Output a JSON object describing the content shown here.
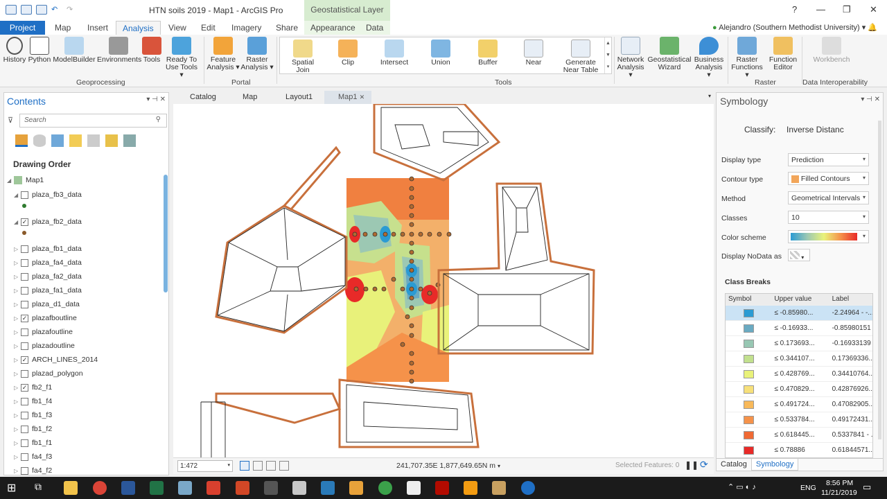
{
  "window": {
    "title": "HTN soils 2019 - Map1 - ArcGIS Pro",
    "context_tab_group": "Geostatistical Layer",
    "help": "?",
    "minimize": "—",
    "maximize": "❐",
    "close": "✕"
  },
  "tabs": {
    "project": "Project",
    "map": "Map",
    "insert": "Insert",
    "analysis": "Analysis",
    "view": "View",
    "edit": "Edit",
    "imagery": "Imagery",
    "share": "Share",
    "appearance": "Appearance",
    "data": "Data"
  },
  "user": "Alejandro (Southern Methodist University)",
  "ribbon": {
    "history": "History",
    "python": "Python",
    "modelbuilder": "ModelBuilder",
    "environments": "Environments",
    "tools": "Tools",
    "ready1": "Ready To",
    "ready2": "Use Tools ▾",
    "geoprocessing": "Geoprocessing",
    "feature1": "Feature",
    "feature2": "Analysis ▾",
    "raster1": "Raster",
    "raster2": "Analysis ▾",
    "portal": "Portal",
    "spatial1": "Spatial",
    "spatial2": "Join",
    "clip": "Clip",
    "intersect": "Intersect",
    "union": "Union",
    "buffer": "Buffer",
    "near": "Near",
    "gnt1": "Generate",
    "gnt2": "Near Table",
    "tools_group": "Tools",
    "network1": "Network",
    "network2": "Analysis ▾",
    "geostat1": "Geostatistical",
    "geostat2": "Wizard",
    "business1": "Business",
    "business2": "Analysis ▾",
    "rfunc1": "Raster",
    "rfunc2": "Functions ▾",
    "fedit1": "Function",
    "fedit2": "Editor",
    "raster_group": "Raster",
    "workbench": "Workbench",
    "data_interop": "Data Interoperability"
  },
  "contents": {
    "title": "Contents",
    "search_placeholder": "Search",
    "drawing_order": "Drawing Order",
    "map": "Map1",
    "layers": [
      "plaza_fb3_data",
      "plaza_fb2_data",
      "plaza_fb1_data",
      "plaza_fa4_data",
      "plaza_fa2_data",
      "plaza_fa1_data",
      "plaza_d1_data",
      "plazafboutline",
      "plazafoutline",
      "plazadoutline",
      "ARCH_LINES_2014",
      "plazad_polygon",
      "fb2_f1",
      "fb1_f4",
      "fb1_f3",
      "fb1_f2",
      "fb1_f1",
      "fa4_f3",
      "fa4_f2"
    ]
  },
  "view_tabs": {
    "catalog": "Catalog",
    "map": "Map",
    "layout1": "Layout1",
    "map1": "Map1"
  },
  "status": {
    "scale": "1:472",
    "coords": "241,707.35E 1,877,649.65N m",
    "selected": "Selected Features: 0"
  },
  "symbology": {
    "title": "Symbology",
    "classify_label": "Classify:",
    "classify_value": "Inverse Distanc",
    "display_type_label": "Display type",
    "display_type": "Prediction",
    "contour_type_label": "Contour type",
    "contour_type": "Filled Contours",
    "method_label": "Method",
    "method": "Geometrical Intervals",
    "classes_label": "Classes",
    "classes": "10",
    "color_scheme_label": "Color scheme",
    "nodata_label": "Display NoData as",
    "class_breaks_title": "Class Breaks",
    "col_symbol": "Symbol",
    "col_upper": "Upper value",
    "col_label": "Label",
    "breaks": [
      {
        "color": "#2b9bd3",
        "upper": "≤ -0.85980...",
        "label": "-2.24964 - -..."
      },
      {
        "color": "#6aaac2",
        "upper": "≤ -0.16933...",
        "label": "-0.85980151"
      },
      {
        "color": "#98c7b3",
        "upper": "≤ 0.173693...",
        "label": "-0.16933139"
      },
      {
        "color": "#c2e08e",
        "upper": "≤ 0.344107...",
        "label": "0.17369336..."
      },
      {
        "color": "#e9f27a",
        "upper": "≤ 0.428769...",
        "label": "0.34410764..."
      },
      {
        "color": "#f7e07a",
        "upper": "≤ 0.470829...",
        "label": "0.42876926..."
      },
      {
        "color": "#f8b95a",
        "upper": "≤ 0.491724...",
        "label": "0.47082905..."
      },
      {
        "color": "#f5924a",
        "upper": "≤ 0.533784...",
        "label": "0.49172431..."
      },
      {
        "color": "#f06a34",
        "upper": "≤ 0.618445...",
        "label": "0.5337841 - ..."
      },
      {
        "color": "#e82a28",
        "upper": "≤ 0.78886",
        "label": "0.61844571..."
      }
    ],
    "bottom_tab_catalog": "Catalog",
    "bottom_tab_symbology": "Symbology"
  },
  "taskbar": {
    "lang": "ENG",
    "time": "8:56 PM",
    "date": "11/21/2019"
  }
}
